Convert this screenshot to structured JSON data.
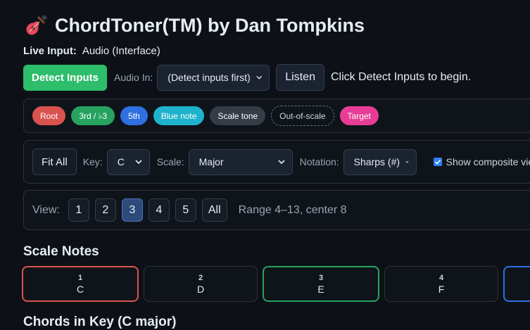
{
  "header": {
    "title": "ChordToner(TM) by Dan Tompkins",
    "icon": "guitar-icon"
  },
  "live_input": {
    "label": "Live Input:",
    "value": "Audio (Interface)"
  },
  "controls": {
    "detect_label": "Detect Inputs",
    "audio_in_label": "Audio In:",
    "audio_in_value": "(Detect inputs first)",
    "listen_label": "Listen",
    "status": "Click Detect Inputs to begin."
  },
  "legend": [
    {
      "label": "Root",
      "color": "#d9534f",
      "style": "solid"
    },
    {
      "label": "3rd / ♭3",
      "color": "#27a35f",
      "style": "solid"
    },
    {
      "label": "5th",
      "color": "#2f6fe0",
      "style": "solid"
    },
    {
      "label": "Blue note",
      "color": "#1fb2cc",
      "style": "solid"
    },
    {
      "label": "Scale tone",
      "color": "#363c46",
      "style": "solid"
    },
    {
      "label": "Out-of-scale",
      "color": "#0f141b",
      "style": "dashed"
    },
    {
      "label": "Target",
      "color": "#e83d96",
      "style": "solid"
    }
  ],
  "settings": {
    "fit_label": "Fit All",
    "key_label": "Key:",
    "key_value": "C",
    "scale_label": "Scale:",
    "scale_value": "Major",
    "notation_label": "Notation:",
    "notation_value": "Sharps (#)",
    "composite_label": "Show composite view",
    "composite_checked": true
  },
  "view": {
    "label": "View:",
    "buttons": [
      "1",
      "2",
      "3",
      "4",
      "5",
      "All"
    ],
    "active": "3",
    "range": "Range 4–13, center 8"
  },
  "scale_notes": {
    "title": "Scale Notes",
    "notes": [
      {
        "degree": "1",
        "name": "C",
        "border": "#d9534f"
      },
      {
        "degree": "2",
        "name": "D",
        "border": "#2d333b"
      },
      {
        "degree": "3",
        "name": "E",
        "border": "#27a35f"
      },
      {
        "degree": "4",
        "name": "F",
        "border": "#2d333b"
      },
      {
        "degree": "",
        "name": "",
        "border": "#2f6fe0"
      }
    ]
  },
  "chords": {
    "title": "Chords in Key (C major)"
  }
}
